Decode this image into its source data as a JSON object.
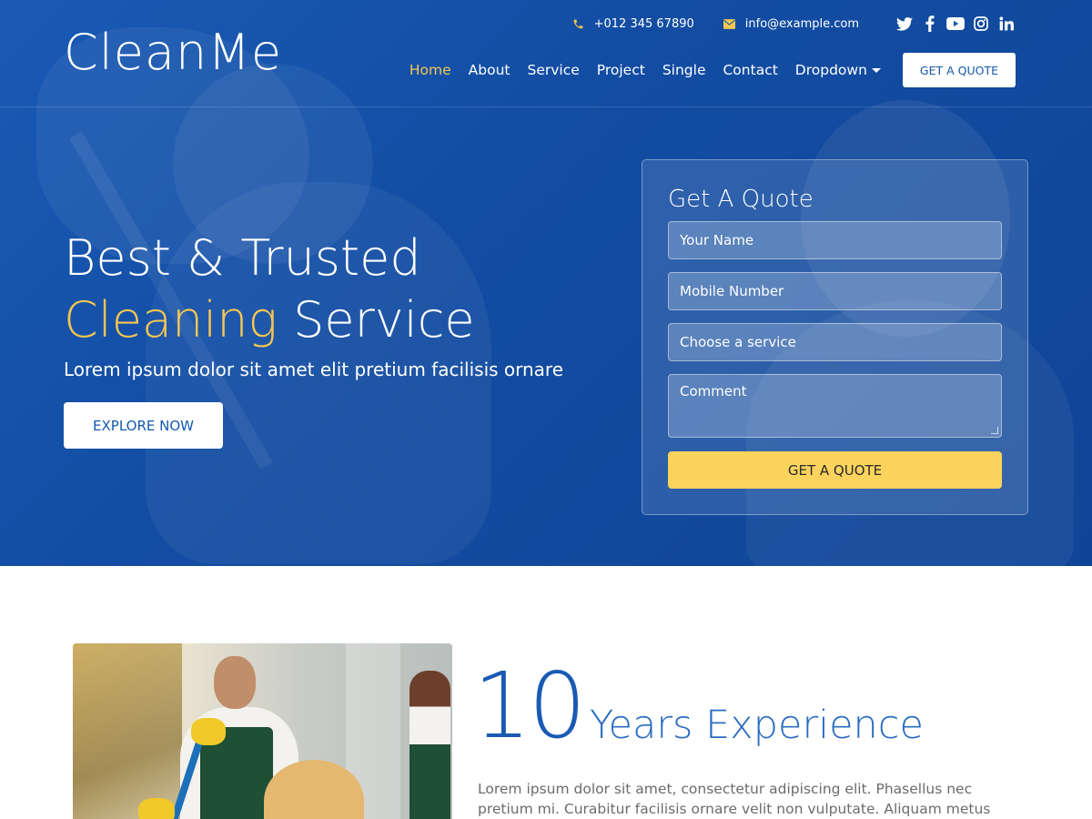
{
  "brand": {
    "logo": "CleanMe"
  },
  "topbar": {
    "phone": "+012 345 67890",
    "email": "info@example.com",
    "social": [
      "twitter-icon",
      "facebook-icon",
      "youtube-icon",
      "instagram-icon",
      "linkedin-icon"
    ]
  },
  "nav": {
    "items": [
      "Home",
      "About",
      "Service",
      "Project",
      "Single",
      "Contact",
      "Dropdown"
    ],
    "active": "Home",
    "quote_button": "GET A QUOTE"
  },
  "hero": {
    "title_line1": "Best & Trusted",
    "title_highlight": "Cleaning",
    "title_rest": "Service",
    "subtitle": "Lorem ipsum dolor sit amet elit pretium facilisis ornare",
    "cta": "EXPLORE NOW"
  },
  "quote_form": {
    "title": "Get A Quote",
    "name_placeholder": "Your Name",
    "mobile_placeholder": "Mobile Number",
    "service_placeholder": "Choose a service",
    "comment_placeholder": "Comment",
    "submit": "GET A QUOTE"
  },
  "about": {
    "years": "10",
    "years_label": "Years Experience",
    "text": "Lorem ipsum dolor sit amet, consectetur adipiscing elit. Phasellus nec pretium mi. Curabitur facilisis ornare velit non vulputate. Aliquam metus tortor, auctor"
  },
  "colors": {
    "primary": "#1459b0",
    "accent": "#f6c750",
    "button_yellow": "#fbd35d"
  }
}
